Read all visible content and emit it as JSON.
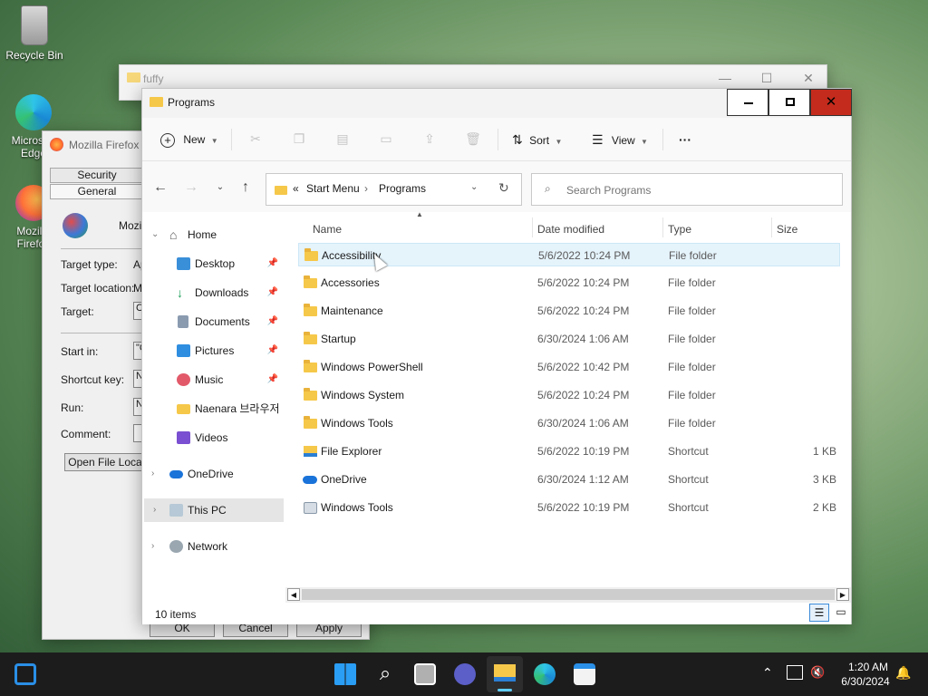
{
  "desktop": {
    "icons": [
      {
        "label": "Recycle Bin"
      },
      {
        "label": "Microsoft Edge"
      },
      {
        "label": "Mozilla Firefox"
      }
    ]
  },
  "back_window": {
    "title": "fuffy"
  },
  "properties": {
    "title": "Mozilla Firefox",
    "tabs": [
      "Security",
      "General"
    ],
    "name_partial": "Mozill",
    "labels": [
      "Target type:",
      "Target location:",
      "Target:",
      "Start in:",
      "Shortcut key:",
      "Run:",
      "Comment:"
    ],
    "values_partial": [
      "Ap",
      "M",
      "C",
      "\"C",
      "N",
      "N",
      ""
    ],
    "open_location_btn": "Open File Loca",
    "buttons": [
      "OK",
      "Cancel",
      "Apply"
    ]
  },
  "explorer": {
    "title": "Programs",
    "toolbar": {
      "new_label": "New",
      "sort_label": "Sort",
      "view_label": "View",
      "more_label": "···"
    },
    "address": {
      "prefix": "«",
      "segments": [
        "Start Menu",
        "Programs"
      ]
    },
    "search": {
      "placeholder": "Search Programs"
    },
    "nav": [
      {
        "label": "Home"
      },
      {
        "label": "Desktop"
      },
      {
        "label": "Downloads"
      },
      {
        "label": "Documents"
      },
      {
        "label": "Pictures"
      },
      {
        "label": "Music"
      },
      {
        "label": "Naenara 브라우저"
      },
      {
        "label": "Videos"
      },
      {
        "label": "OneDrive"
      },
      {
        "label": "This PC"
      },
      {
        "label": "Network"
      }
    ],
    "columns": [
      "Name",
      "Date modified",
      "Type",
      "Size"
    ],
    "rows": [
      {
        "name": "Accessibility",
        "date": "5/6/2022 10:24 PM",
        "type": "File folder",
        "size": ""
      },
      {
        "name": "Accessories",
        "date": "5/6/2022 10:24 PM",
        "type": "File folder",
        "size": ""
      },
      {
        "name": "Maintenance",
        "date": "5/6/2022 10:24 PM",
        "type": "File folder",
        "size": ""
      },
      {
        "name": "Startup",
        "date": "6/30/2024 1:06 AM",
        "type": "File folder",
        "size": ""
      },
      {
        "name": "Windows PowerShell",
        "date": "5/6/2022 10:42 PM",
        "type": "File folder",
        "size": ""
      },
      {
        "name": "Windows System",
        "date": "5/6/2022 10:24 PM",
        "type": "File folder",
        "size": ""
      },
      {
        "name": "Windows Tools",
        "date": "6/30/2024 1:06 AM",
        "type": "File folder",
        "size": ""
      },
      {
        "name": "File Explorer",
        "date": "5/6/2022 10:19 PM",
        "type": "Shortcut",
        "size": "1 KB"
      },
      {
        "name": "OneDrive",
        "date": "6/30/2024 1:12 AM",
        "type": "Shortcut",
        "size": "3 KB"
      },
      {
        "name": "Windows Tools",
        "date": "5/6/2022 10:19 PM",
        "type": "Shortcut",
        "size": "2 KB"
      }
    ],
    "status": "10 items"
  },
  "taskbar": {
    "time": "1:20 AM",
    "date": "6/30/2024"
  }
}
